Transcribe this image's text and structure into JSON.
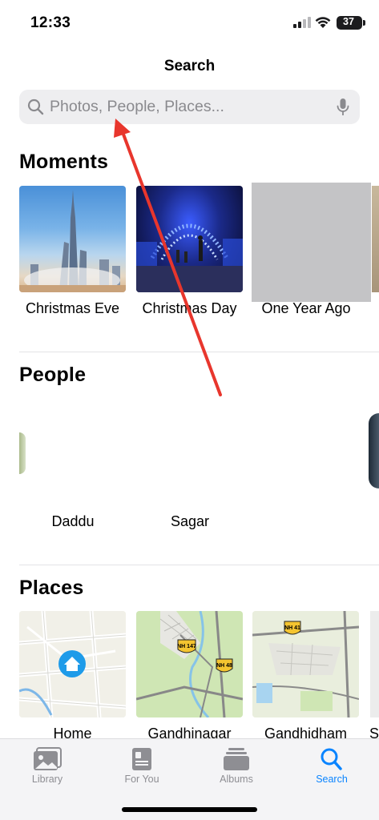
{
  "status_bar": {
    "time": "12:33",
    "battery": "37"
  },
  "header": {
    "title": "Search"
  },
  "search": {
    "placeholder": "Photos, People, Places..."
  },
  "moments": {
    "title": "Moments",
    "items": [
      {
        "label": "Christmas Eve"
      },
      {
        "label": "Christmas Day"
      },
      {
        "label": "One Year Ago"
      }
    ]
  },
  "people": {
    "title": "People",
    "items": [
      {
        "label": "Daddu"
      },
      {
        "label": "Sagar"
      }
    ]
  },
  "places": {
    "title": "Places",
    "items": [
      {
        "label": "Home"
      },
      {
        "label": "Gandhinagar",
        "shields": [
          "NH 147",
          "NH 48"
        ]
      },
      {
        "label": "Gandhidham",
        "shields": [
          "NH 41"
        ]
      }
    ],
    "partial_label": "S"
  },
  "tab_bar": {
    "tabs": [
      {
        "label": "Library",
        "icon": "photo-library-icon"
      },
      {
        "label": "For You",
        "icon": "for-you-icon"
      },
      {
        "label": "Albums",
        "icon": "albums-icon"
      },
      {
        "label": "Search",
        "icon": "search-icon",
        "active": true
      }
    ]
  },
  "colors": {
    "accent": "#0a84ff",
    "annotation_arrow": "#e8362d",
    "map_marker": "#1e9be9"
  }
}
